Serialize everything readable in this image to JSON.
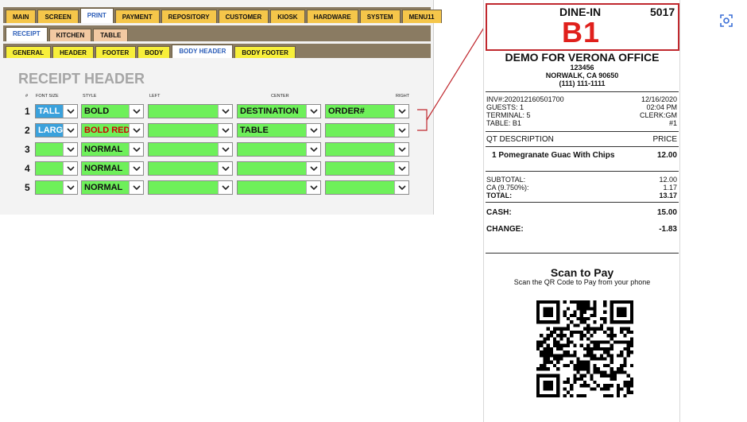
{
  "nav": {
    "main_tabs": [
      {
        "label": "MAIN",
        "active": false
      },
      {
        "label": "SCREEN",
        "active": false
      },
      {
        "label": "PRINT",
        "active": true
      },
      {
        "label": "PAYMENT",
        "active": false
      },
      {
        "label": "REPOSITORY",
        "active": false
      },
      {
        "label": "CUSTOMER",
        "active": false
      },
      {
        "label": "KIOSK",
        "active": false
      },
      {
        "label": "HARDWARE",
        "active": false
      },
      {
        "label": "SYSTEM",
        "active": false
      },
      {
        "label": "MENU11",
        "active": false
      }
    ],
    "print_tabs": [
      {
        "label": "RECEIPT",
        "active": true
      },
      {
        "label": "KITCHEN",
        "active": false
      },
      {
        "label": "TABLE",
        "active": false
      }
    ],
    "receipt_tabs": [
      {
        "label": "GENERAL",
        "active": false
      },
      {
        "label": "HEADER",
        "active": false
      },
      {
        "label": "FOOTER",
        "active": false
      },
      {
        "label": "BODY",
        "active": false
      },
      {
        "label": "BODY HEADER",
        "active": true
      },
      {
        "label": "BODY FOOTER",
        "active": false
      }
    ]
  },
  "settings": {
    "title": "RECEIPT HEADER",
    "columns": {
      "num": "#",
      "font_size": "FONT SIZE",
      "style": "STYLE",
      "left": "LEFT",
      "center": "CENTER",
      "right": "RIGHT"
    },
    "rows": [
      {
        "num": "1",
        "font_size": "TALL",
        "style": "BOLD",
        "left": "",
        "center": "DESTINATION",
        "right": "ORDER#"
      },
      {
        "num": "2",
        "font_size": "LARGE",
        "style": "BOLD RED",
        "left": "",
        "center": "TABLE",
        "right": ""
      },
      {
        "num": "3",
        "font_size": "",
        "style": "NORMAL",
        "left": "",
        "center": "",
        "right": ""
      },
      {
        "num": "4",
        "font_size": "",
        "style": "NORMAL",
        "left": "",
        "center": "",
        "right": ""
      },
      {
        "num": "5",
        "font_size": "",
        "style": "NORMAL",
        "left": "",
        "center": "",
        "right": ""
      }
    ]
  },
  "receipt": {
    "destination": "DINE-IN",
    "order_no": "5017",
    "table_big": "B1",
    "store_name": "DEMO FOR VERONA OFFICE",
    "address1": "123456",
    "address2": "NORWALK, CA 90650",
    "phone": "(111) 111-1111",
    "inv": "INV#:202012160501700",
    "date": "12/16/2020",
    "guests": "GUESTS: 1",
    "time": "02:04 PM",
    "terminal": "TERMINAL: 5",
    "clerk": "CLERK:GM",
    "table": "TABLE: B1",
    "seq": "#1",
    "col_desc": "QT DESCRIPTION",
    "col_price": "PRICE",
    "item_desc": "1 Pomegranate Guac With Chips",
    "item_price": "12.00",
    "subtotal_label": "SUBTOTAL:",
    "subtotal": "12.00",
    "tax_label": "CA (9.750%):",
    "tax": "1.17",
    "total_label": "TOTAL:",
    "total": "13.17",
    "cash_label": "CASH:",
    "cash": "15.00",
    "change_label": "CHANGE:",
    "change": "-1.83",
    "scan_title": "Scan to Pay",
    "scan_sub": "Scan the QR Code to Pay from your phone"
  },
  "colors": {
    "highlight": "#c0282e",
    "select_green": "#6ef05a",
    "select_blue": "#3aa1dc"
  }
}
